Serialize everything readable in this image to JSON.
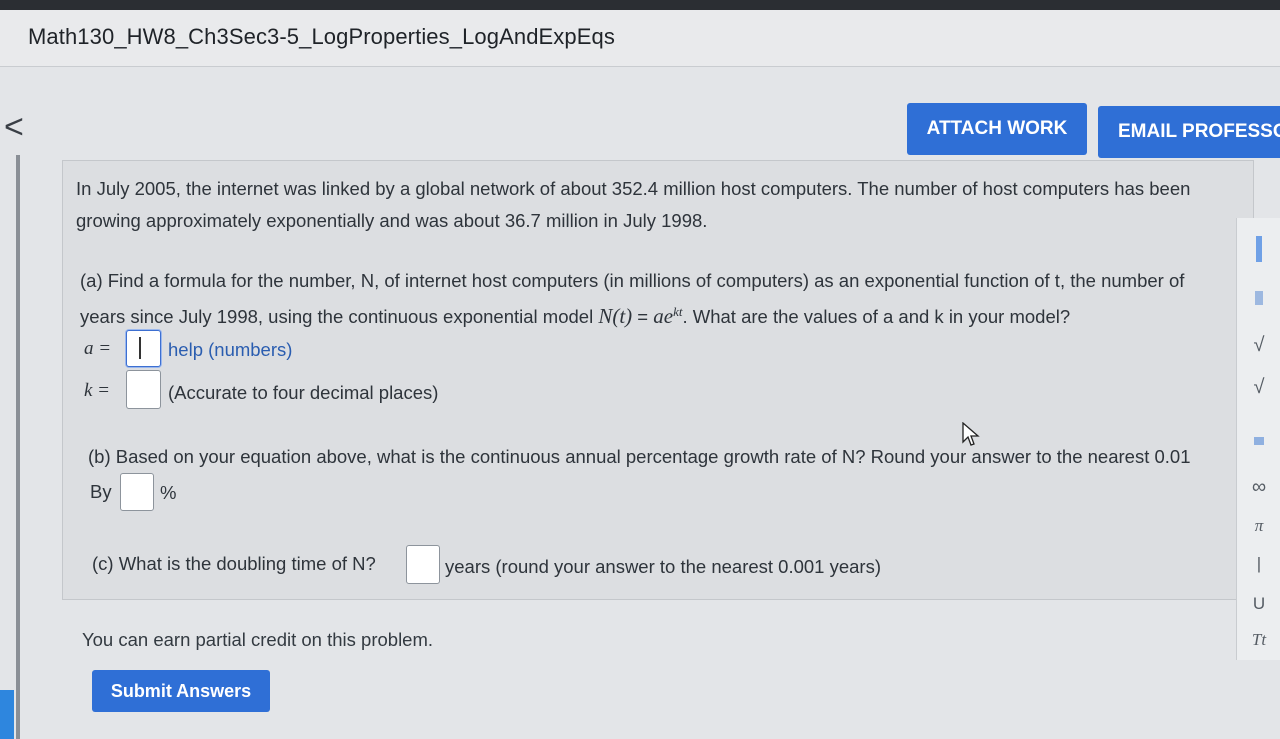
{
  "window": {
    "title": "Math130_HW8_Ch3Sec3-5_LogProperties_LogAndExpEqs"
  },
  "nav": {
    "back_icon": "chevron-left-icon",
    "back_glyph": "<"
  },
  "actions": {
    "attach_label": "ATTACH WORK",
    "email_label": "EMAIL PROFESSOR"
  },
  "problem": {
    "intro_line1": "In July 2005, the internet was linked by a global network of about 352.4 million host computers. The number of host computers has been",
    "intro_line2": "growing approximately exponentially and was about 36.7 million in July 1998.",
    "part_a_line1": "(a) Find a formula for the number, N, of internet host computers (in millions of computers) as an exponential function of t, the number of",
    "part_a_line2_pre": "years since July 1998, using the continuous exponential model",
    "part_a_formula_lhs": "N(t)",
    "part_a_formula_eq": " = ",
    "part_a_formula_rhs": "ae",
    "part_a_formula_exp": "kt",
    "part_a_line2_post": ". What are the values of a and k in your model?",
    "a_label": "a =",
    "a_value": "",
    "a_help": "help (numbers)",
    "k_label": "k =",
    "k_value": "",
    "k_note": "(Accurate to four decimal places)",
    "part_b_line1": "(b) Based on your equation above, what is the continuous annual percentage growth rate of N? Round your answer to the nearest 0.01",
    "part_b_by": "By",
    "part_b_value": "",
    "part_b_unit": "%",
    "part_c_pre": "(c) What is the doubling time of N?",
    "part_c_value": "",
    "part_c_post": "years (round your answer to the nearest 0.001 years)"
  },
  "toolbar": {
    "sqrt_label": "√",
    "nthroot_label": "√",
    "infinity_label": "∞",
    "pi_label": "π",
    "abs_label": "|",
    "union_label": "U",
    "text_label": "Tt"
  },
  "footer": {
    "credit_text": "You can earn partial credit on this problem.",
    "submit_label": "Submit Answers"
  },
  "colors": {
    "accent": "#2f6fd6",
    "link": "#2a5db0"
  }
}
